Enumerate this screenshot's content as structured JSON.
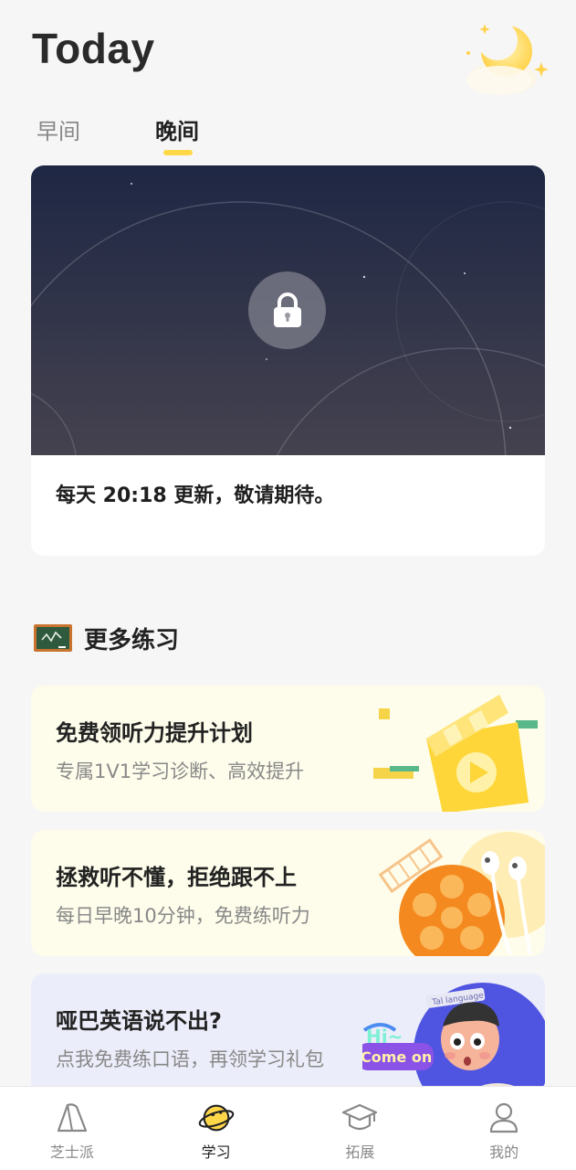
{
  "header": {
    "title": "Today"
  },
  "tabs": [
    {
      "label": "早间",
      "active": false
    },
    {
      "label": "晚间",
      "active": true
    }
  ],
  "lock_card": {
    "caption": "每天 20:18 更新，敬请期待。"
  },
  "practice": {
    "section_title": "更多练习",
    "items": [
      {
        "title": "免费领听力提升计划",
        "subtitle": "专属1V1学习诊断、高效提升"
      },
      {
        "title": "拯救听不懂，拒绝跟不上",
        "subtitle": "每日早晚10分钟，免费练听力"
      },
      {
        "title": "哑巴英语说不出?",
        "subtitle": "点我免费练口语，再领学习礼包",
        "badge_hi": "Hi~",
        "badge_come_on": "Come on",
        "tag_text": "Tal language"
      }
    ]
  },
  "tabbar": [
    {
      "label": "芝士派",
      "icon": "cheese-icon",
      "active": false
    },
    {
      "label": "学习",
      "icon": "planet-icon",
      "active": true
    },
    {
      "label": "拓展",
      "icon": "graduation-cap-icon",
      "active": false
    },
    {
      "label": "我的",
      "icon": "user-icon",
      "active": false
    }
  ],
  "colors": {
    "accent": "#ffd84a",
    "lock_bg_top": "#1e2744",
    "lock_bg_bottom": "#43414f",
    "promo_yellow": "#fefdeb",
    "promo_lilac": "#ecedfa"
  }
}
